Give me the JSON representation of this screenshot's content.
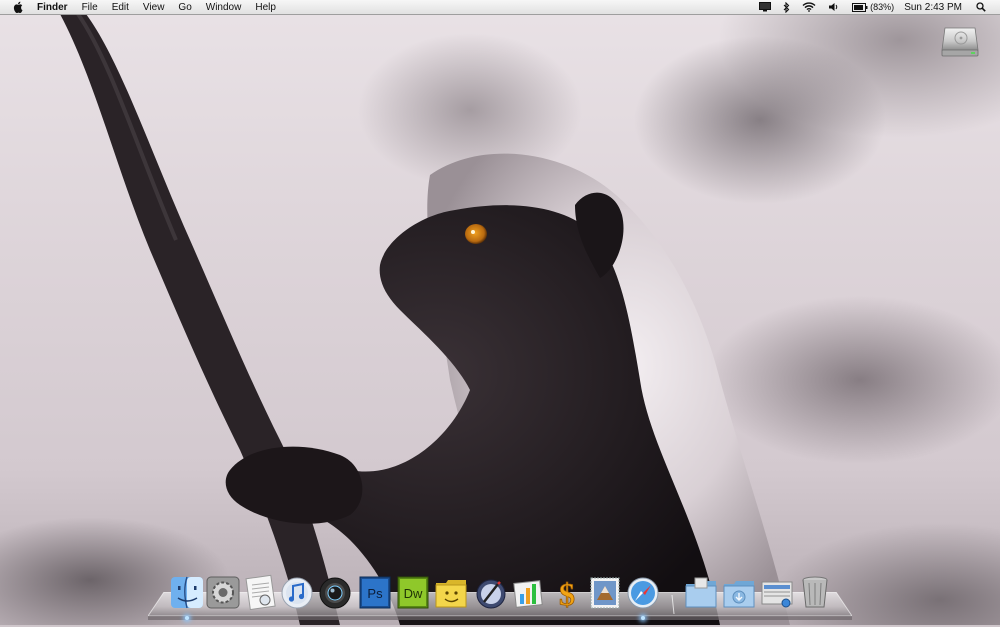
{
  "menubar": {
    "apple_icon": "apple-logo-icon",
    "app_name": "Finder",
    "items": [
      "File",
      "Edit",
      "View",
      "Go",
      "Window",
      "Help"
    ],
    "status": {
      "display_icon": "display-mirroring-icon",
      "bluetooth_icon": "bluetooth-icon",
      "wifi_icon": "wifi-icon",
      "volume_icon": "volume-icon",
      "battery_icon": "battery-icon",
      "battery_percent": "(83%)",
      "clock": "Sun 2:43 PM",
      "spotlight_icon": "spotlight-search-icon"
    }
  },
  "desktop": {
    "hard_drive_icon": "hard-drive-icon"
  },
  "dock": {
    "apps": [
      {
        "icon": "finder-icon",
        "running": true
      },
      {
        "icon": "system-preferences-icon",
        "running": false
      },
      {
        "icon": "textedit-preview-icon",
        "running": false
      },
      {
        "icon": "itunes-icon",
        "running": false
      },
      {
        "icon": "aperture-icon",
        "running": false
      },
      {
        "icon": "photoshop-icon",
        "label": "Ps",
        "running": false
      },
      {
        "icon": "dreamweaver-icon",
        "label": "Dw",
        "running": false
      },
      {
        "icon": "smiley-folder-icon",
        "running": false
      },
      {
        "icon": "script-editor-icon",
        "running": false
      },
      {
        "icon": "numbers-icon",
        "running": false
      },
      {
        "icon": "dollar-app-icon",
        "label": "$",
        "running": false
      },
      {
        "icon": "mail-stamp-icon",
        "running": false
      },
      {
        "icon": "safari-icon",
        "running": true
      }
    ],
    "stacks": [
      {
        "icon": "applications-folder-icon"
      },
      {
        "icon": "downloads-folder-icon"
      },
      {
        "icon": "documents-stack-icon"
      },
      {
        "icon": "trash-icon"
      }
    ]
  }
}
